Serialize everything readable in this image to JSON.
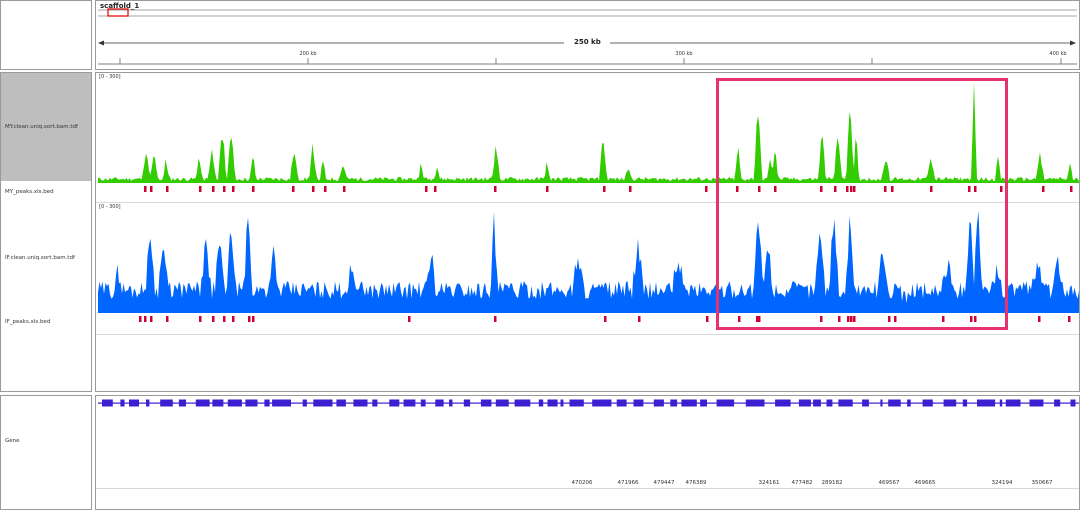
{
  "header": {
    "chromosome": "scaffold_1",
    "span_label": "250 kb",
    "ruler_ticks": [
      "200 kb",
      "300 kb",
      "400 kb"
    ]
  },
  "tracks": {
    "track1_name": "MY.clean.uniq.sort.bam.tdf",
    "track1_scale": "[0 - 300]",
    "track1_color": "#33cc00",
    "track2_name": "MY_peaks.xls.bed",
    "track2_color": "#cc0033",
    "track3_name": "IF.clean.uniq.sort.bam.tdf",
    "track3_scale": "[0 - 300]",
    "track3_color": "#0066ff",
    "track4_name": "IF_peaks.xls.bed",
    "track4_color": "#cc0033",
    "highlight_box_color": "#e6336e"
  },
  "gene_panel": {
    "track_name": "Gene",
    "gene_color": "#3b1fd1",
    "gene_ids": [
      "470206",
      "471966",
      "479447",
      "476389",
      "324161",
      "477482",
      "289182",
      "469567",
      "469665",
      "324194",
      "350667"
    ]
  }
}
